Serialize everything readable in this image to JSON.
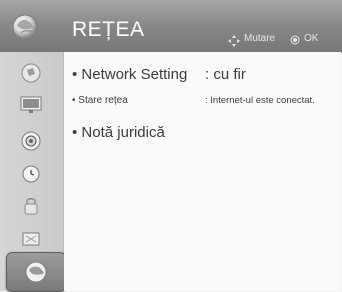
{
  "header": {
    "title": "REȚEA",
    "hints": {
      "move_label": "Mutare",
      "ok_label": "OK"
    }
  },
  "sidebar": {
    "items": [
      {
        "name": "picture",
        "icon": "picture-icon"
      },
      {
        "name": "tv",
        "icon": "tv-icon"
      },
      {
        "name": "audio",
        "icon": "speaker-icon"
      },
      {
        "name": "time",
        "icon": "clock-icon"
      },
      {
        "name": "lock",
        "icon": "lock-icon"
      },
      {
        "name": "option",
        "icon": "option-icon"
      },
      {
        "name": "network",
        "icon": "network-globe-icon",
        "active": true
      }
    ]
  },
  "menu": {
    "network_setting": {
      "label": "• Network Setting",
      "value": ": cu fir"
    },
    "network_status": {
      "label": "• Stare rețea",
      "value": ": Internet-ul este conectat."
    },
    "legal_note": {
      "label": "• Notă juridică"
    }
  },
  "colors": {
    "header": "#8a8a8a",
    "sidebar": "#cccccc",
    "content": "#fafafa",
    "text": "#3c3c3c"
  }
}
